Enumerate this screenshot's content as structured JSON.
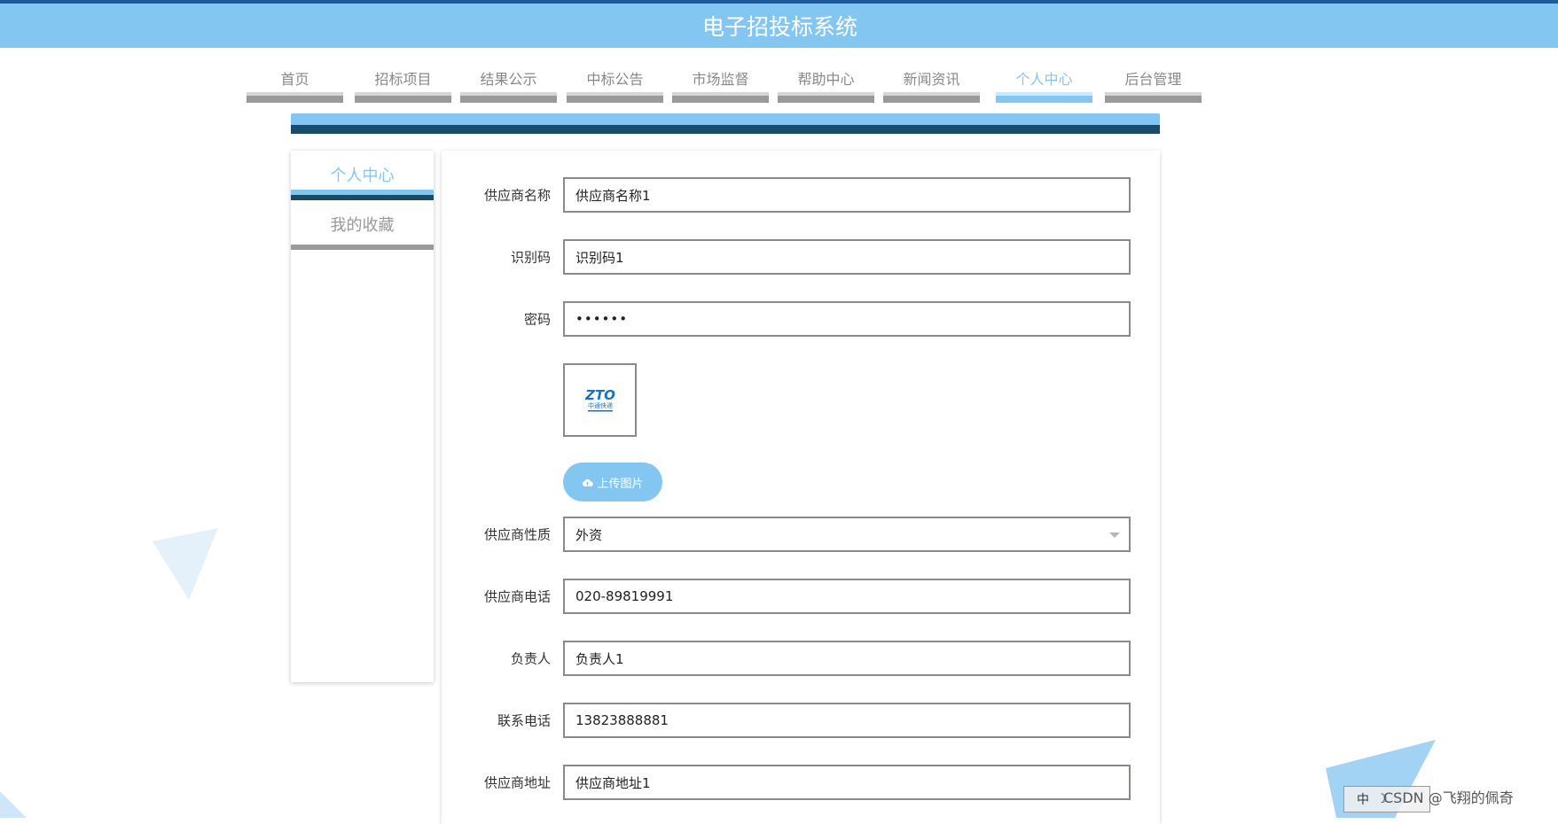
{
  "header": {
    "title": "电子招投标系统"
  },
  "nav": {
    "items": [
      {
        "label": "首页",
        "active": false
      },
      {
        "label": "招标项目",
        "active": false
      },
      {
        "label": "结果公示",
        "active": false
      },
      {
        "label": "中标公告",
        "active": false
      },
      {
        "label": "市场监督",
        "active": false
      },
      {
        "label": "帮助中心",
        "active": false
      },
      {
        "label": "新闻资讯",
        "active": false
      },
      {
        "label": "个人中心",
        "active": true
      },
      {
        "label": "后台管理",
        "active": false
      }
    ]
  },
  "sidebar": {
    "items": [
      {
        "label": "个人中心",
        "active": true
      },
      {
        "label": "我的收藏",
        "active": false
      }
    ]
  },
  "form": {
    "supplier_name": {
      "label": "供应商名称",
      "value": "供应商名称1"
    },
    "id_code": {
      "label": "识别码",
      "value": "识别码1"
    },
    "password": {
      "label": "密码",
      "value": "••••••"
    },
    "image": {
      "logo_text": "ZTO",
      "logo_subtext": "中通快递"
    },
    "upload_button": {
      "label": "上传图片",
      "icon": "cloud-upload-icon"
    },
    "supplier_type": {
      "label": "供应商性质",
      "value": "外资"
    },
    "supplier_phone": {
      "label": "供应商电话",
      "value": "020-89819991"
    },
    "contact_person": {
      "label": "负责人",
      "value": "负责人1"
    },
    "contact_phone": {
      "label": "联系电话",
      "value": "13823888881"
    },
    "supplier_address": {
      "label": "供应商地址",
      "value": "供应商地址1"
    }
  },
  "overlay": {
    "watermark": "CSDN @飞翔的佩奇",
    "ime_char": "中"
  },
  "colors": {
    "primary": "#84c6f2",
    "dark": "#1b4b6b",
    "border": "#8b8a84"
  }
}
